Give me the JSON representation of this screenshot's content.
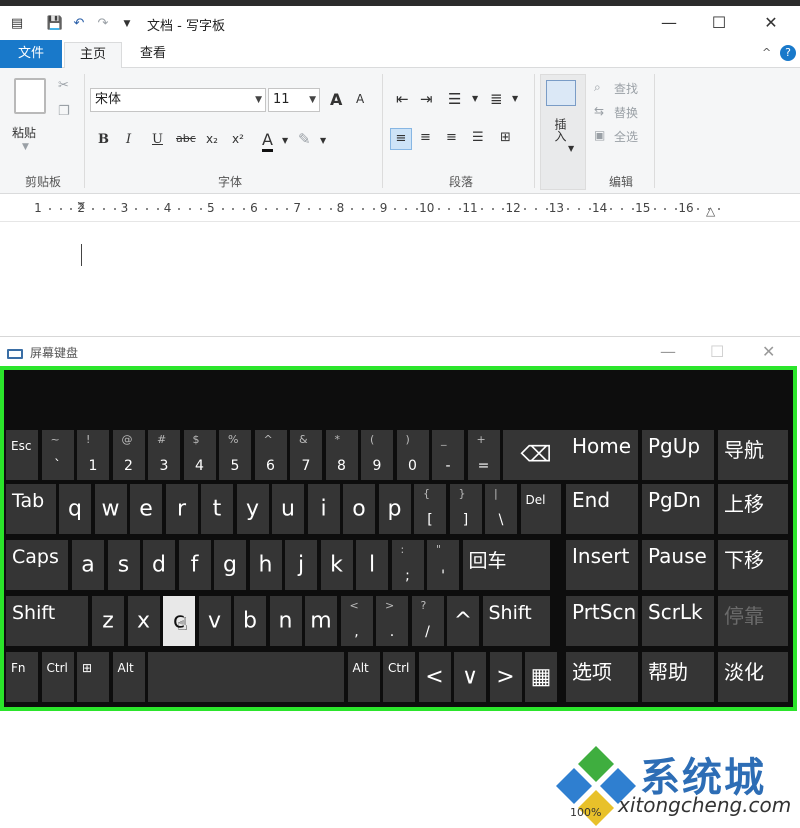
{
  "wordpad": {
    "title": "文档 - 写字板",
    "tabs": {
      "file": "文件",
      "home": "主页",
      "view": "查看"
    },
    "clipboard": {
      "paste_label": "粘贴",
      "group_label": "剪贴板"
    },
    "font": {
      "family": "宋体",
      "size": "11",
      "group_label": "字体",
      "bold": "B",
      "italic": "I",
      "underline": "U",
      "strike": "abc",
      "subscript": "x₂",
      "superscript": "x²",
      "color": "A",
      "grow": "A",
      "shrink": "A"
    },
    "paragraph": {
      "group_label": "段落"
    },
    "insert": {
      "label": "插入"
    },
    "editing": {
      "find": "查找",
      "replace": "替换",
      "select_all": "全选",
      "group_label": "编辑"
    },
    "ruler": [
      "1",
      "2",
      "3",
      "4",
      "5",
      "6",
      "7",
      "8",
      "9",
      "10",
      "11",
      "12",
      "13",
      "14",
      "15",
      "16"
    ]
  },
  "osk": {
    "title": "屏幕键盘",
    "rows": {
      "r1": [
        {
          "main": "Esc"
        },
        {
          "top": "~",
          "bot": "`"
        },
        {
          "top": "!",
          "bot": "1"
        },
        {
          "top": "@",
          "bot": "2"
        },
        {
          "top": "#",
          "bot": "3"
        },
        {
          "top": "$",
          "bot": "4"
        },
        {
          "top": "%",
          "bot": "5"
        },
        {
          "top": "^",
          "bot": "6"
        },
        {
          "top": "&",
          "bot": "7"
        },
        {
          "top": "*",
          "bot": "8"
        },
        {
          "top": "(",
          "bot": "9"
        },
        {
          "top": ")",
          "bot": "0"
        },
        {
          "top": "_",
          "bot": "-"
        },
        {
          "top": "+",
          "bot": "="
        },
        {
          "main": "⌫"
        }
      ],
      "r2": [
        "Tab",
        "q",
        "w",
        "e",
        "r",
        "t",
        "y",
        "u",
        "i",
        "o",
        "p"
      ],
      "r2b": [
        {
          "top": "{",
          "bot": "["
        },
        {
          "top": "}",
          "bot": "]"
        },
        {
          "top": "|",
          "bot": "\\"
        },
        {
          "main": "Del"
        }
      ],
      "r3": [
        "Caps",
        "a",
        "s",
        "d",
        "f",
        "g",
        "h",
        "j",
        "k",
        "l"
      ],
      "r3b": [
        {
          "top": ":",
          "bot": ";"
        },
        {
          "top": "\"",
          "bot": "'"
        },
        {
          "main": "回车"
        }
      ],
      "r4": [
        "Shift",
        "z",
        "x",
        "c",
        "v",
        "b",
        "n",
        "m"
      ],
      "r4b": [
        {
          "top": "<",
          "bot": ","
        },
        {
          "top": ">",
          "bot": "."
        },
        {
          "top": "?",
          "bot": "/"
        },
        {
          "main": "^"
        },
        {
          "main": "Shift"
        }
      ],
      "r5": [
        "Fn",
        "Ctrl",
        "⊞",
        "Alt",
        "",
        "Alt",
        "Ctrl",
        "<",
        "∨",
        ">",
        "▦"
      ]
    },
    "nav": [
      [
        "Home",
        "PgUp",
        "导航"
      ],
      [
        "End",
        "PgDn",
        "上移"
      ],
      [
        "Insert",
        "Pause",
        "下移"
      ],
      [
        "PrtScn",
        "ScrLk",
        "停靠"
      ],
      [
        "选项",
        "帮助",
        "淡化"
      ]
    ]
  },
  "status": {
    "zoom": "100%"
  },
  "watermark": {
    "name": "系统城",
    "url": "xitongcheng.com"
  },
  "colors": {
    "accent": "#1979ca",
    "osk_border": "#2be52b",
    "key_bg": "#353535"
  }
}
